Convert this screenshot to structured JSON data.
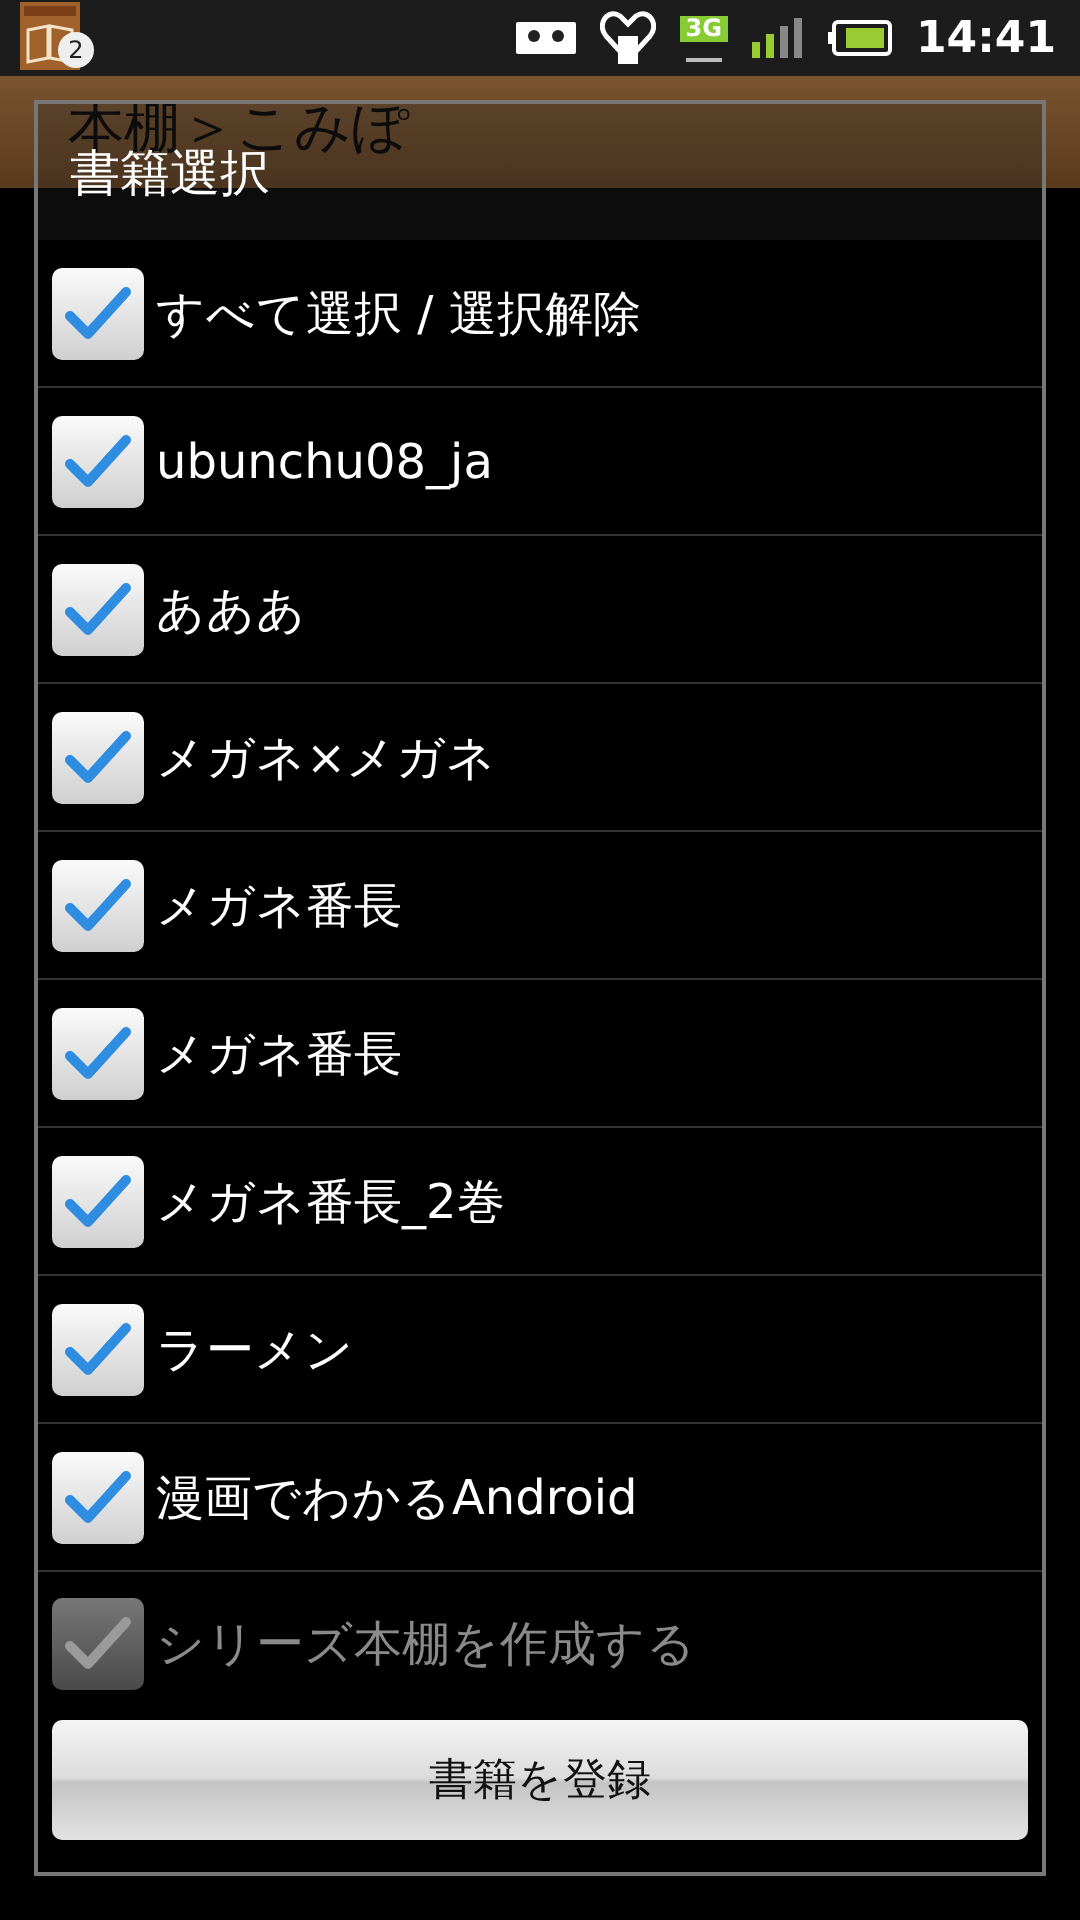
{
  "status_bar": {
    "notification_count": "2",
    "network": "3G",
    "time": "14:41"
  },
  "background": {
    "title": "本棚＞こみぽ"
  },
  "dialog": {
    "title": "書籍選択",
    "items": [
      {
        "label": "すべて選択 / 選択解除",
        "checked": true,
        "disabled": false
      },
      {
        "label": "ubunchu08_ja",
        "checked": true,
        "disabled": false
      },
      {
        "label": "あああ",
        "checked": true,
        "disabled": false
      },
      {
        "label": "メガネ×メガネ",
        "checked": true,
        "disabled": false
      },
      {
        "label": "メガネ番長",
        "checked": true,
        "disabled": false
      },
      {
        "label": "メガネ番長",
        "checked": true,
        "disabled": false
      },
      {
        "label": "メガネ番長_2巻",
        "checked": true,
        "disabled": false
      },
      {
        "label": "ラーメン",
        "checked": true,
        "disabled": false
      },
      {
        "label": "漫画でわかるAndroid",
        "checked": true,
        "disabled": false
      }
    ],
    "series_option": {
      "label": "シリーズ本棚を作成する",
      "checked": true,
      "disabled": true
    },
    "button": "書籍を登録"
  }
}
